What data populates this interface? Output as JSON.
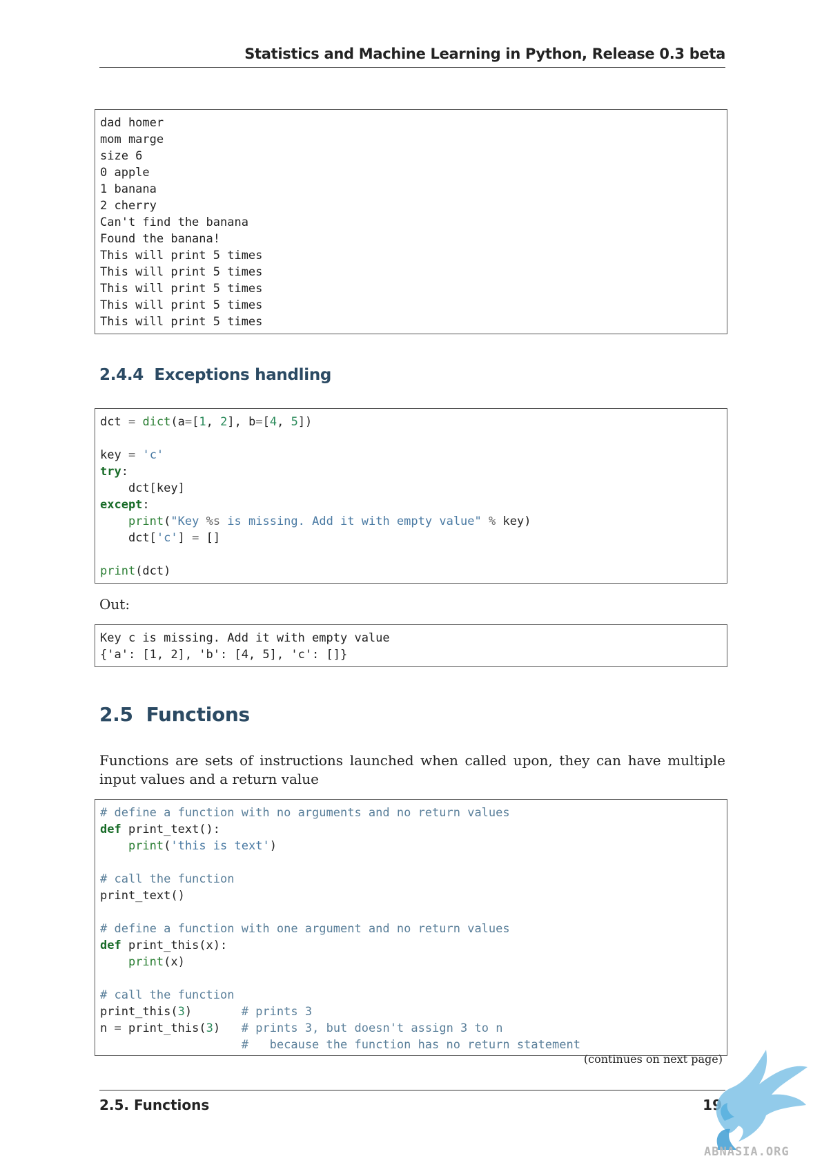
{
  "header": {
    "title": "Statistics and Machine Learning in Python, Release 0.3 beta"
  },
  "output1": {
    "lines": [
      "dad homer",
      "mom marge",
      "size 6",
      "0 apple",
      "1 banana",
      "2 cherry",
      "Can't find the banana",
      "Found the banana!",
      "This will print 5 times",
      "This will print 5 times",
      "This will print 5 times",
      "This will print 5 times",
      "This will print 5 times"
    ]
  },
  "section_244": {
    "number": "2.4.4",
    "title": "Exceptions handling"
  },
  "code_exceptions": {
    "lines": [
      "dct = dict(a=[1, 2], b=[4, 5])",
      "",
      "key = 'c'",
      "try:",
      "    dct[key]",
      "except:",
      "    print(\"Key %s is missing. Add it with empty value\" % key)",
      "    dct['c'] = []",
      "",
      "print(dct)"
    ]
  },
  "out_label": "Out:",
  "output2": {
    "lines": [
      "Key c is missing. Add it with empty value",
      "{'a': [1, 2], 'b': [4, 5], 'c': []}"
    ]
  },
  "section_25": {
    "number": "2.5",
    "title": "Functions"
  },
  "paragraph": "Functions are sets of instructions launched when called upon, they can have multiple input values and a return value",
  "code_functions": {
    "lines": [
      "# define a function with no arguments and no return values",
      "def print_text():",
      "    print('this is text')",
      "",
      "# call the function",
      "print_text()",
      "",
      "# define a function with one argument and no return values",
      "def print_this(x):",
      "    print(x)",
      "",
      "# call the function",
      "print_this(3)       # prints 3",
      "n = print_this(3)   # prints 3, but doesn't assign 3 to n",
      "                    #   because the function has no return statement"
    ]
  },
  "continues_note": "(continues on next page)",
  "footer": {
    "section": "2.5. Functions",
    "page": "19"
  },
  "watermark": {
    "text": "ABNASIA.ORG",
    "icon": "griffin-logo"
  }
}
